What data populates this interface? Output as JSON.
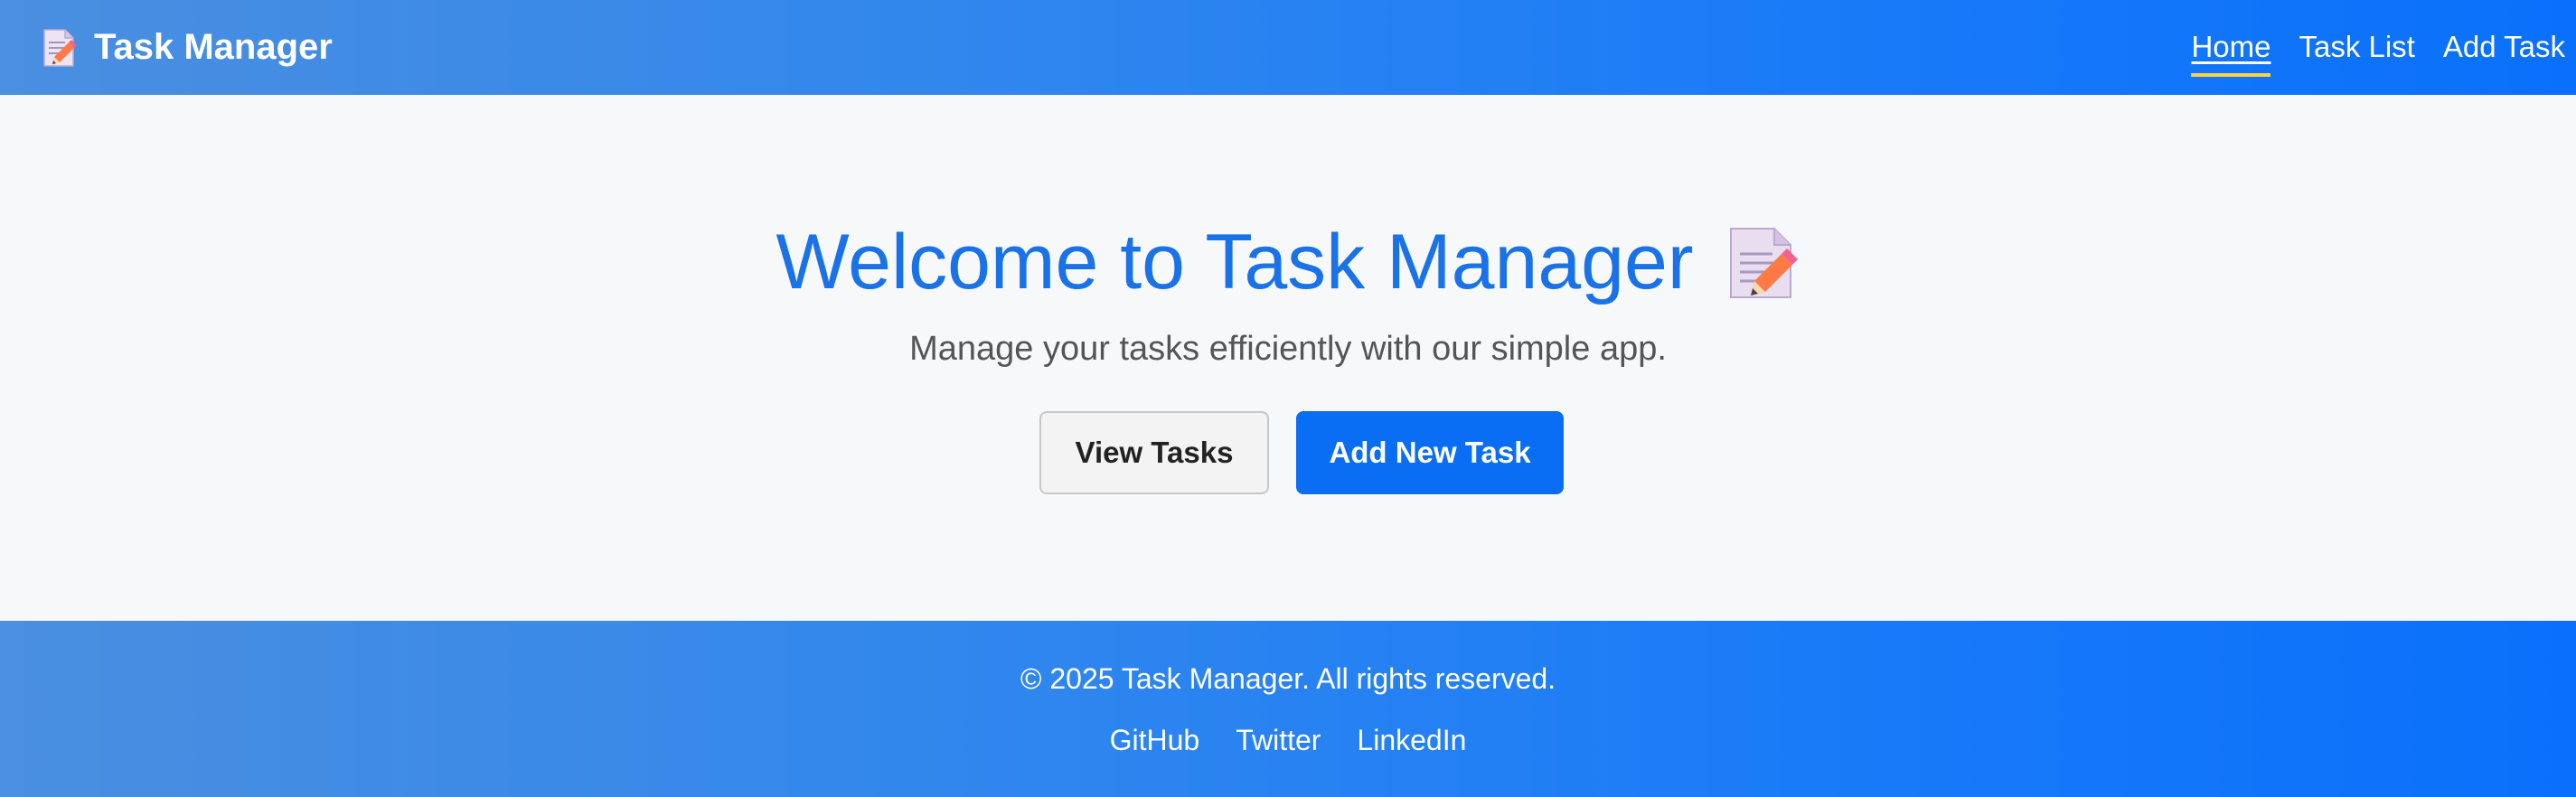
{
  "header": {
    "brand_icon": "memo-icon",
    "title": "Task Manager",
    "nav": [
      {
        "label": "Home",
        "active": true
      },
      {
        "label": "Task List",
        "active": false
      },
      {
        "label": "Add Task",
        "active": false
      }
    ]
  },
  "hero": {
    "title": "Welcome to Task Manager",
    "title_icon": "memo-icon",
    "subtitle": "Manage your tasks efficiently with our simple app.",
    "buttons": {
      "view_tasks": "View Tasks",
      "add_task": "Add New Task"
    }
  },
  "footer": {
    "copyright": "© 2025 Task Manager. All rights reserved.",
    "links": [
      "GitHub",
      "Twitter",
      "LinkedIn"
    ]
  },
  "colors": {
    "header_gradient_start": "#4a8fe0",
    "header_gradient_end": "#0a70fb",
    "primary": "#0a6ef5",
    "hero_title": "#1a72e8",
    "active_underline": "#ffd23f",
    "background": "#f7f8fa"
  }
}
